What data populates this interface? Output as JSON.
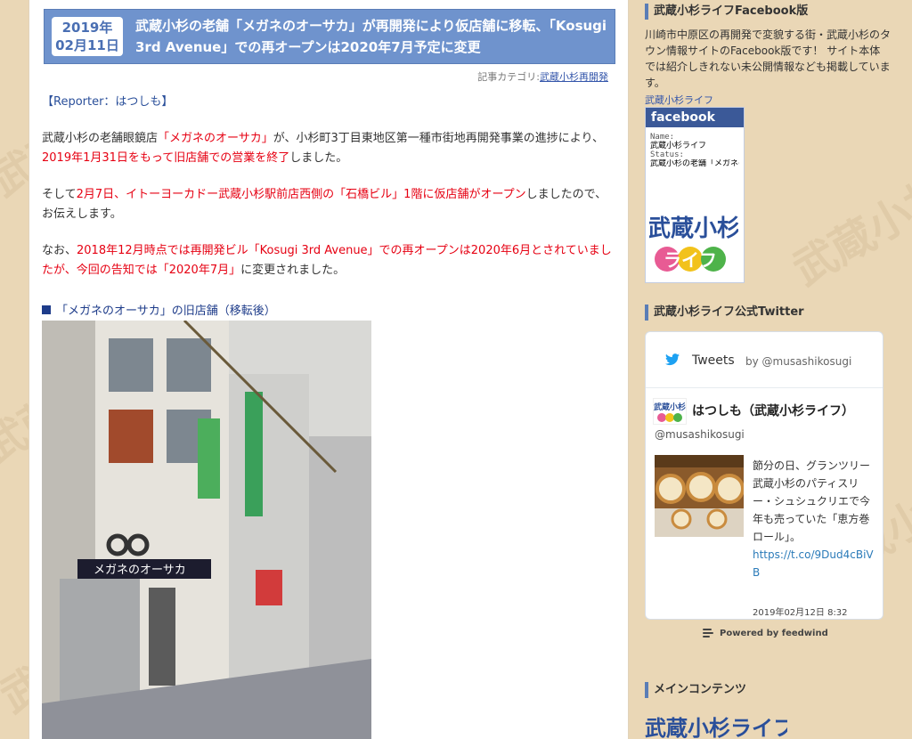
{
  "article": {
    "date_year": "2019年",
    "date_day": "02月11日",
    "title": "武蔵小杉の老舗「メガネのオーサカ」が再開発により仮店舗に移転、「Kosugi 3rd Avenue」での再オープンは2020年7月予定に変更",
    "category_label": "記事カテゴリ:",
    "category_link": "武蔵小杉再開発",
    "reporter": "【Reporter：はつしも】",
    "p1": {
      "a": "武蔵小杉の老舗眼鏡店",
      "b": "「メガネのオーサカ」",
      "c": "が、小杉町3丁目東地区第一種市街地再開発事業の進捗により、",
      "d": "2019年1月31日をもって旧店舗での営業を終了",
      "e": "しました。"
    },
    "p2": {
      "a": "そして",
      "b": "2月7日、イトーヨーカドー武蔵小杉駅前店西側の「石橋ビル」1階に仮店舗がオープン",
      "c": "しましたので、",
      "d": "お伝えします。"
    },
    "p3": {
      "a": "なお、",
      "b": "2018年12月時点では再開発ビル「Kosugi 3rd Avenue」での再オープンは2020年6月とされていましたが、今回の告知では「2020年7月」",
      "c": "に変更されました。"
    },
    "caption": "「メガネのオーサカ」の旧店舗（移転後）",
    "photo_sign": "メガネのオーサカ"
  },
  "sidebar": {
    "facebook_heading": "武蔵小杉ライフFacebook版",
    "facebook_desc": "川崎市中原区の再開発で変貌する街・武蔵小杉のタウン情報サイトのFacebook版です！ サイト本体では紹介しきれない未公開情報なども掲載しています。",
    "fb_page_link": "武蔵小杉ライフ",
    "fb_brand": "facebook",
    "fb_name_label": "Name:",
    "fb_name": "武蔵小杉ライフ",
    "fb_status_label": "Status:",
    "fb_status": "武蔵小杉の老舗「メガネのオーサカ」が再開",
    "logo_line1": "武蔵小杉",
    "logo_line2": "ライフ",
    "twitter_heading": "武蔵小杉ライフ公式Twitter",
    "tw_title": "Tweets",
    "tw_by": "by @musashikosugi",
    "tw_name": "はつしも（武蔵小杉ライフ）",
    "tw_handle": "@musashikosugi",
    "tw_text": "節分の日、グランツリー武蔵小杉のパティスリー・シュシュクリエで今年も売っていた「恵方巻ロール」。",
    "tw_link": "https://t.co/9Dud4cBiVB",
    "tw_time": "2019年02月12日 8:32",
    "feedwind": "Powered by feedwind",
    "main_contents_heading": "メインコンテンツ",
    "main_logo_text": "武蔵小杉ライフ"
  },
  "colors": {
    "header_blue": "#6f93cd",
    "accent_red": "#e60012",
    "link_blue": "#3355aa",
    "facebook_blue": "#3b5998"
  }
}
